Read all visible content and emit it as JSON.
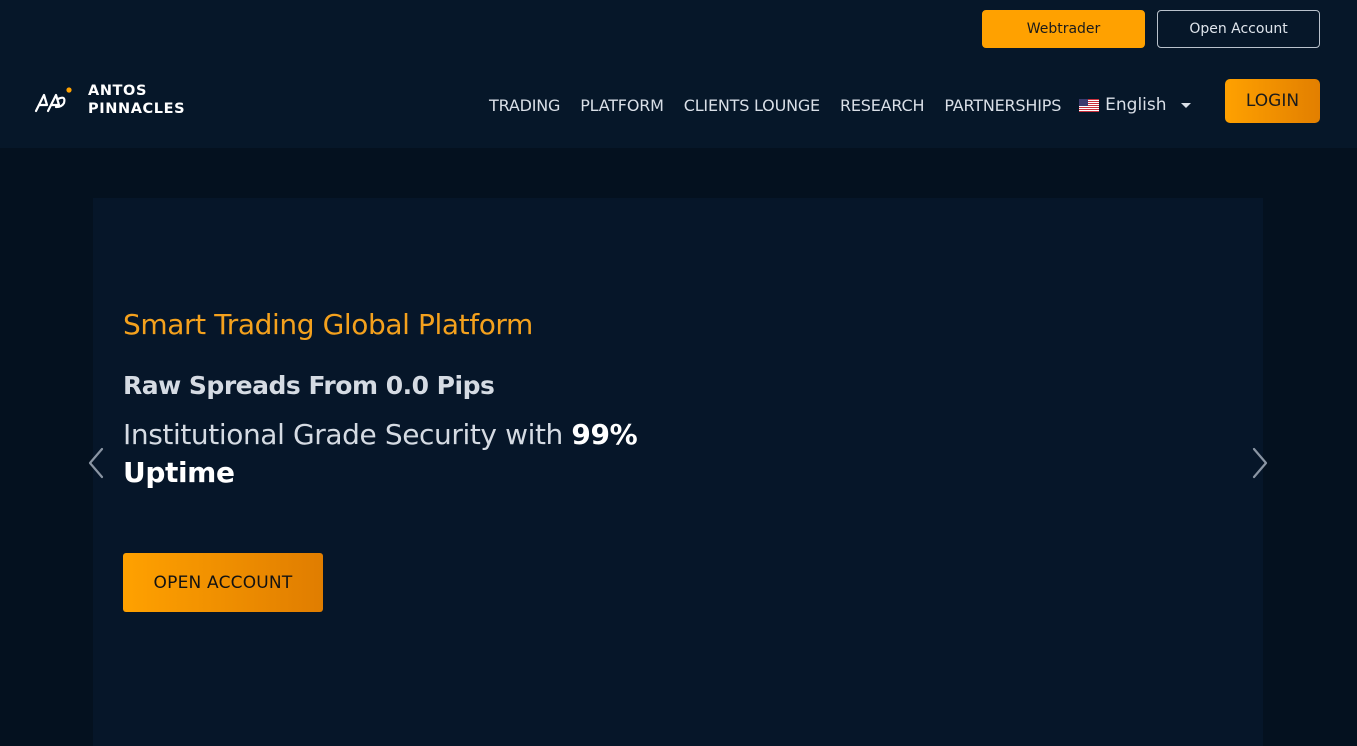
{
  "header": {
    "top_buttons": {
      "webtrader": "Webtrader",
      "open_account": "Open Account"
    },
    "logo": {
      "line1": "ANTOS",
      "line2": "PINNACLES"
    },
    "nav": [
      "TRADING",
      "PLATFORM",
      "CLIENTS LOUNGE",
      "RESEARCH",
      "PARTNERSHIPS"
    ],
    "language": "English",
    "language_icon": "us-flag-icon",
    "login": "LOGIN"
  },
  "hero": {
    "title": "Smart Trading Global Platform",
    "subtitle": "Raw Spreads From 0.0 Pips",
    "security_text": "Institutional Grade Security with ",
    "security_bold": "99% Uptime",
    "cta": "OPEN ACCOUNT",
    "prev_icon": "chevron-left-icon",
    "next_icon": "chevron-right-icon"
  },
  "colors": {
    "accent": "#ffa100",
    "title": "#f4a11d",
    "background": "#04111f",
    "header": "#061729"
  }
}
